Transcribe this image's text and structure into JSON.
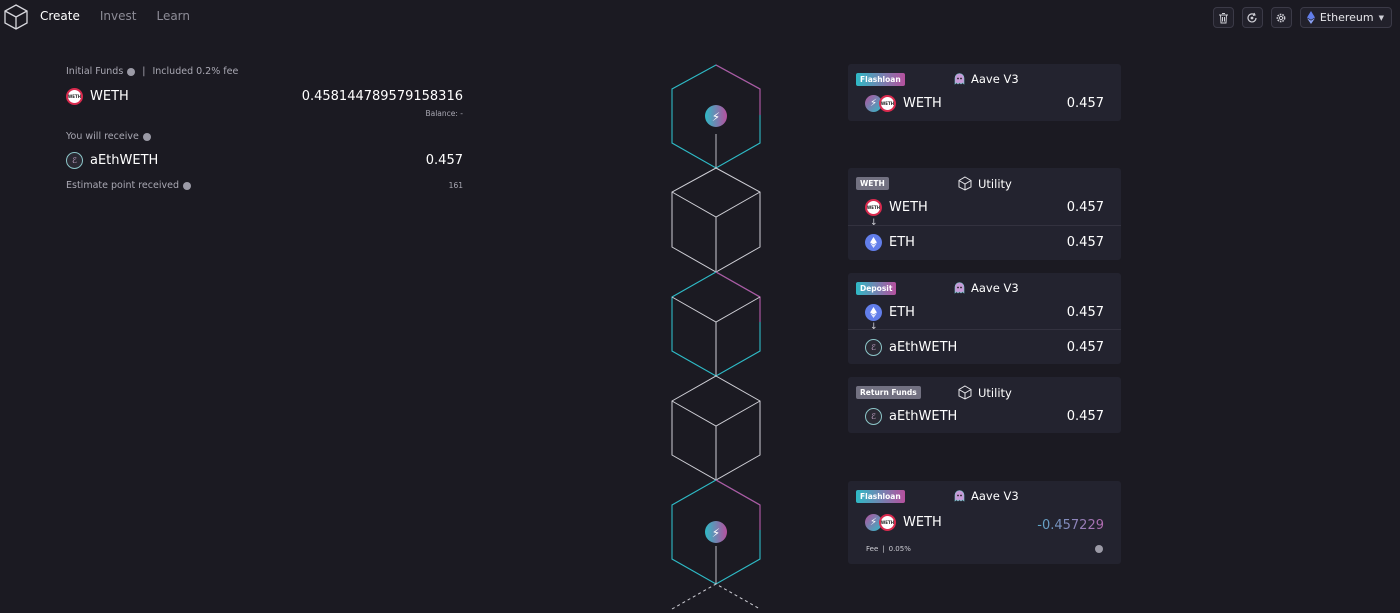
{
  "nav": {
    "items": [
      "Create",
      "Invest",
      "Learn"
    ],
    "active": "Create"
  },
  "network": {
    "label": "Ethereum"
  },
  "initial_funds": {
    "label": "Initial Funds",
    "fee_note": "Included 0.2% fee",
    "separator": "|",
    "token": "WETH",
    "amount": "0.458144789579158316",
    "balance": "Balance: -"
  },
  "receive": {
    "label": "You will receive",
    "token": "aEthWETH",
    "amount": "0.457",
    "points_label": "Estimate point received",
    "points": "161"
  },
  "icons": {
    "logo": "cube-logo-icon",
    "trash": "trash-icon",
    "refresh": "refresh-icon",
    "settings": "gear-icon",
    "eth": "ethereum-icon",
    "aave": "aave-ghost-icon",
    "utility": "cube-icon"
  },
  "colors": {
    "teal": "#2ebac6",
    "pink": "#b6509e",
    "eth": "#627eea",
    "weth_red": "#d92a4e"
  },
  "cards": [
    {
      "badge": "Flashloan",
      "protocol": "Aave V3",
      "rows": [
        {
          "token": "WETH",
          "value": "0.457"
        }
      ]
    },
    {
      "badge": "WETH",
      "protocol": "Utility",
      "rows": [
        {
          "token": "WETH",
          "value": "0.457"
        },
        {
          "token": "ETH",
          "value": "0.457"
        }
      ],
      "arrow": "↓"
    },
    {
      "badge": "Deposit",
      "protocol": "Aave V3",
      "rows": [
        {
          "token": "ETH",
          "value": "0.457"
        },
        {
          "token": "aEthWETH",
          "value": "0.457"
        }
      ],
      "arrow": "↓"
    },
    {
      "badge": "Return Funds",
      "protocol": "Utility",
      "rows": [
        {
          "token": "aEthWETH",
          "value": "0.457"
        }
      ]
    },
    {
      "badge": "Flashloan",
      "protocol": "Aave V3",
      "rows": [
        {
          "token": "WETH",
          "value": "-0.457229"
        }
      ],
      "fee_label": "Fee",
      "fee_separator": "|",
      "fee_value": "0.05%"
    }
  ]
}
